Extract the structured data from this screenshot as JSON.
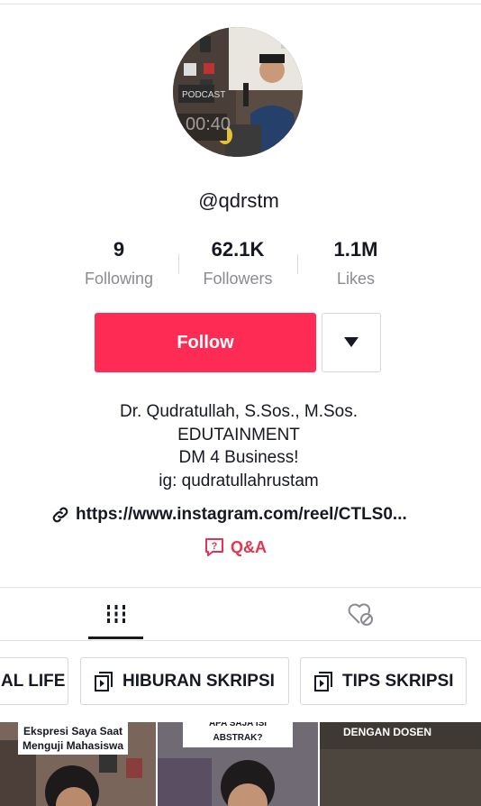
{
  "profile": {
    "username": "@qdrstm",
    "avatar_timestamp": "00:40"
  },
  "stats": [
    {
      "value": "9",
      "label": "Following"
    },
    {
      "value": "62.1K",
      "label": "Followers"
    },
    {
      "value": "1.1M",
      "label": "Likes"
    }
  ],
  "actions": {
    "follow_label": "Follow",
    "more_icon": "triangle-down-icon"
  },
  "bio": {
    "lines": [
      "Dr. Qudratullah, S.Sos., M.Sos.",
      "EDUTAINMENT",
      "DM 4 Business!",
      "ig: qudratullahrustam"
    ],
    "link": "https://www.instagram.com/reel/CTLS0...",
    "qa_label": "Q&A"
  },
  "tabs": {
    "videos_icon": "grid-icon",
    "liked_icon": "heart-lock-icon",
    "active": "videos"
  },
  "playlists": [
    {
      "label": "AL LIFE"
    },
    {
      "label": "HIBURAN SKRIPSI"
    },
    {
      "label": "TIPS SKRIPSI"
    }
  ],
  "thumbnails": [
    {
      "caption": "Ekspresi Saya Saat Menguji Mahasiswa"
    },
    {
      "caption": "APA SAJA ISI ABSTRAK?"
    },
    {
      "caption": "DENGAN DOSEN"
    }
  ],
  "colors": {
    "accent": "#fe2c55",
    "qa": "#e8334e",
    "text": "#161823",
    "muted": "#8a8b91"
  }
}
